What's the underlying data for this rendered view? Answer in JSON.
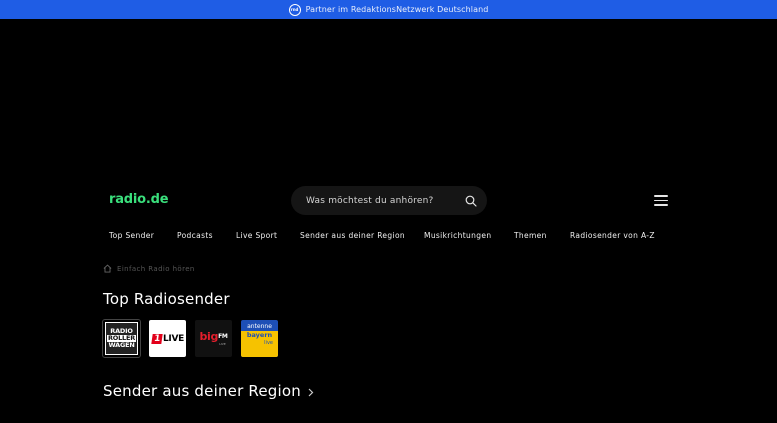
{
  "partner": {
    "logo_text": "rnd",
    "text": "Partner im RedaktionsNetzwerk Deutschland"
  },
  "header": {
    "logo": "radio.de",
    "search_placeholder": "Was möchtest du anhören?"
  },
  "nav": {
    "items": [
      {
        "label": "Top Sender"
      },
      {
        "label": "Podcasts"
      },
      {
        "label": "Live Sport"
      },
      {
        "label": "Sender aus deiner Region"
      },
      {
        "label": "Musikrichtungen"
      },
      {
        "label": "Themen"
      },
      {
        "label": "Radiosender von A-Z"
      }
    ]
  },
  "breadcrumb": {
    "text": "Einfach Radio hören"
  },
  "top_section": {
    "title": "Top Radiosender",
    "stations": [
      {
        "name": "Radio Rollerwagen",
        "logo_lines": [
          "RADIO",
          "ROLLER",
          "WAGEN"
        ]
      },
      {
        "name": "1LIVE",
        "logo_prefix": "",
        "logo_mark": "1",
        "logo_suffix": "LIVE"
      },
      {
        "name": "bigFM",
        "logo_main": "big",
        "logo_sup": "FM",
        "logo_sub": "LIVE"
      },
      {
        "name": "antenne bayern live",
        "logo_top": "antenne",
        "logo_mid": "bayern",
        "logo_bottom": "live"
      }
    ]
  },
  "region_section": {
    "title": "Sender aus deiner Region"
  },
  "colors": {
    "partner_bar": "#1f5de5",
    "logo_green": "#3adf7c",
    "background": "#000000"
  }
}
